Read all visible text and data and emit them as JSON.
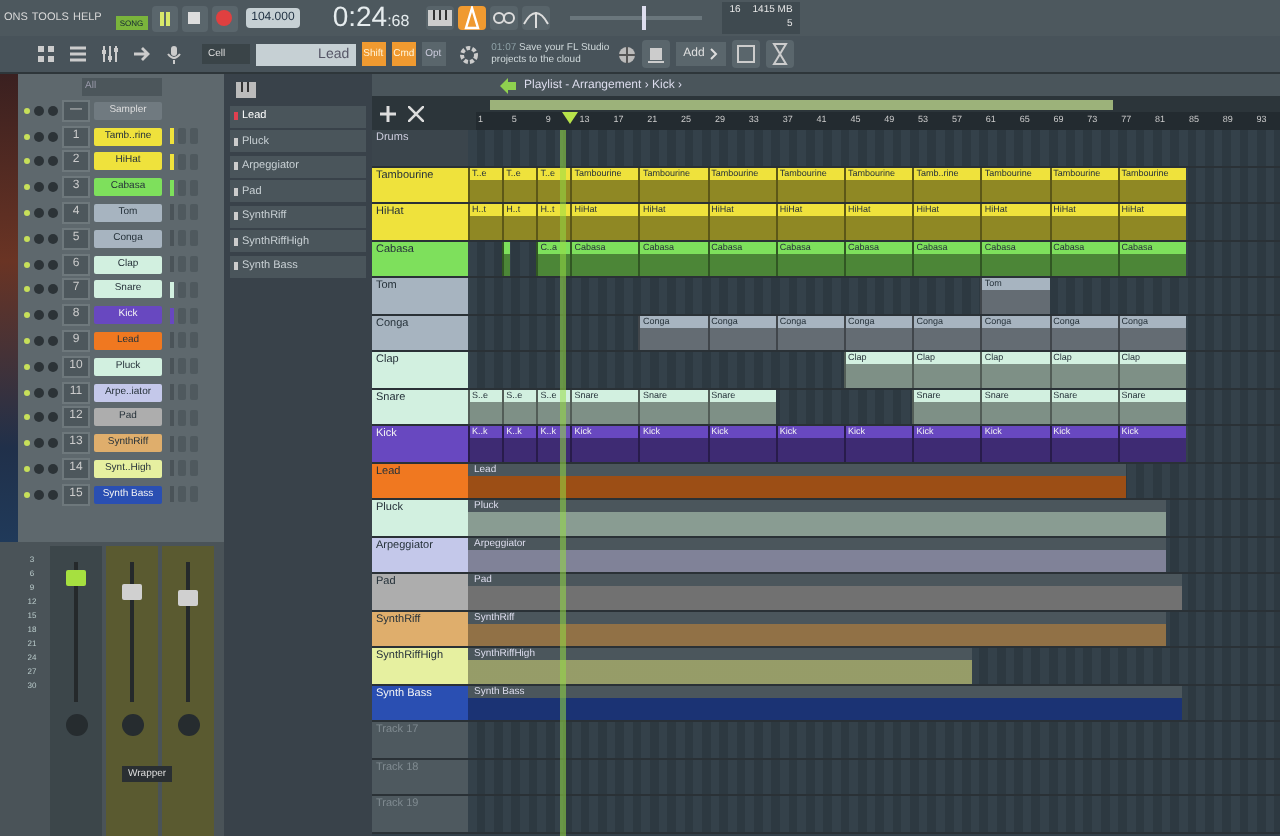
{
  "menu": [
    "ONS",
    "TOOLS",
    "HELP"
  ],
  "transport": {
    "mode": "SONG",
    "playing": true,
    "tempo": "104.000",
    "time_main": "0:24",
    "time_sub": ":68"
  },
  "master_pitch": {
    "level": 0.56
  },
  "stats": {
    "cpu": "16",
    "memory": "1415 MB",
    "voices": "5"
  },
  "toolbar": {
    "snap": "Cell",
    "pattern": "Lead",
    "hint_time": "01:07",
    "hint_text": "Save your FL Studio projects to the cloud",
    "add_button": "Add",
    "modifiers": [
      {
        "label": "Shift",
        "on": true
      },
      {
        "label": "Cmd",
        "on": true
      },
      {
        "label": "Opt",
        "on": false
      }
    ]
  },
  "channel_rack": {
    "filter": "All",
    "sampler_number": "—",
    "sampler": "Sampler",
    "channels": [
      {
        "number": "1",
        "name": "Tamb..rine",
        "color": "#efe23c",
        "active": true
      },
      {
        "number": "2",
        "name": "HiHat",
        "color": "#efe23c",
        "active": true
      },
      {
        "number": "3",
        "name": "Cabasa",
        "color": "#7ee05c",
        "active": true
      },
      {
        "number": "4",
        "name": "Tom",
        "color": "#a7b4c0",
        "active": false
      },
      {
        "number": "5",
        "name": "Conga",
        "color": "#a7b4c0",
        "active": false
      },
      {
        "number": "6",
        "name": "Clap",
        "color": "#d2f0e0",
        "active": false
      },
      {
        "number": "7",
        "name": "Snare",
        "color": "#d2f0e0",
        "active": true
      },
      {
        "number": "8",
        "name": "Kick",
        "color": "#6848c0",
        "active": true
      },
      {
        "number": "9",
        "name": "Lead",
        "color": "#f07820",
        "active": false
      },
      {
        "number": "10",
        "name": "Pluck",
        "color": "#d2f0e0",
        "active": false
      },
      {
        "number": "11",
        "name": "Arpe..iator",
        "color": "#c4c8ea",
        "active": false
      },
      {
        "number": "12",
        "name": "Pad",
        "color": "#adadad",
        "active": false
      },
      {
        "number": "13",
        "name": "SynthRiff",
        "color": "#dfae6c",
        "active": false
      },
      {
        "number": "14",
        "name": "Synt..High",
        "color": "#e6f0a0",
        "active": false
      },
      {
        "number": "15",
        "name": "Synth Bass",
        "color": "#2a4fb2",
        "active": false
      }
    ]
  },
  "patterns": [
    {
      "name": "Lead",
      "selected": true
    },
    {
      "name": "Pluck",
      "selected": false
    },
    {
      "name": "Arpeggiator",
      "selected": false
    },
    {
      "name": "Pad",
      "selected": false
    },
    {
      "name": "SynthRiff",
      "selected": false
    },
    {
      "name": "SynthRiffHigh",
      "selected": false
    },
    {
      "name": "Synth Bass",
      "selected": false
    }
  ],
  "mixer": {
    "scale": [
      "3",
      "6",
      "9",
      "12",
      "15",
      "18",
      "21",
      "24",
      "27",
      "30"
    ],
    "strip_label": "Wrapper",
    "strips": [
      {
        "kind": "master",
        "level": 0.88
      },
      {
        "kind": "insert",
        "level": 0.78
      },
      {
        "kind": "insert",
        "level": 0.75
      }
    ]
  },
  "playlist": {
    "title": "Playlist - Arrangement › Kick ›",
    "group": "Drums",
    "playhead": {
      "level": 0.116
    },
    "ruler": [
      "1",
      "5",
      "9",
      "13",
      "17",
      "21",
      "25",
      "29",
      "33",
      "37",
      "41",
      "45",
      "49",
      "53",
      "57",
      "61",
      "65",
      "69",
      "73",
      "77",
      "81",
      "85",
      "89",
      "93"
    ],
    "tracks": [
      {
        "name": "Tambourine",
        "kind": "drum",
        "color": "#efe23c",
        "slots": [
          {
            "kind": "short",
            "label": "T..e"
          },
          {
            "kind": "short",
            "label": "T..e"
          },
          {
            "kind": "short",
            "label": "T..e"
          },
          {
            "kind": "long",
            "label": "Tambourine"
          },
          {
            "kind": "long",
            "label": "Tambourine"
          },
          {
            "kind": "long",
            "label": "Tambourine"
          },
          {
            "kind": "long",
            "label": "Tambourine"
          },
          {
            "kind": "long",
            "label": "Tambourine"
          },
          {
            "kind": "long",
            "label": "Tamb..rine"
          },
          {
            "kind": "long",
            "label": "Tambourine"
          },
          {
            "kind": "long",
            "label": "Tambourine"
          },
          {
            "kind": "long",
            "label": "Tambourine"
          }
        ]
      },
      {
        "name": "HiHat",
        "kind": "drum",
        "color": "#efe23c",
        "slots": [
          {
            "kind": "short",
            "label": "H..t"
          },
          {
            "kind": "short",
            "label": "H..t"
          },
          {
            "kind": "short",
            "label": "H..t"
          },
          {
            "kind": "long",
            "label": "HiHat"
          },
          {
            "kind": "long",
            "label": "HiHat"
          },
          {
            "kind": "long",
            "label": "HiHat"
          },
          {
            "kind": "long",
            "label": "HiHat"
          },
          {
            "kind": "long",
            "label": "HiHat"
          },
          {
            "kind": "long",
            "label": "HiHat"
          },
          {
            "kind": "long",
            "label": "HiHat"
          },
          {
            "kind": "long",
            "label": "HiHat"
          },
          {
            "kind": "long",
            "label": "HiHat"
          }
        ]
      },
      {
        "name": "Cabasa",
        "kind": "drum",
        "color": "#7ee05c",
        "slots": [
          {
            "kind": "rest"
          },
          {
            "kind": "tick"
          },
          {
            "kind": "short",
            "label": "C..a"
          },
          {
            "kind": "long",
            "label": "Cabasa"
          },
          {
            "kind": "long",
            "label": "Cabasa"
          },
          {
            "kind": "long",
            "label": "Cabasa"
          },
          {
            "kind": "long",
            "label": "Cabasa"
          },
          {
            "kind": "long",
            "label": "Cabasa"
          },
          {
            "kind": "long",
            "label": "Cabasa"
          },
          {
            "kind": "long",
            "label": "Cabasa"
          },
          {
            "kind": "long",
            "label": "Cabasa"
          },
          {
            "kind": "long",
            "label": "Cabasa"
          }
        ]
      },
      {
        "name": "Tom",
        "kind": "drum",
        "color": "#a7b4c0",
        "slots": [
          {
            "kind": "pause"
          },
          {
            "kind": "pause"
          },
          {
            "kind": "pause"
          },
          {
            "kind": "pause"
          },
          {
            "kind": "pause"
          },
          {
            "kind": "pause"
          },
          {
            "kind": "pause"
          },
          {
            "kind": "rest"
          },
          {
            "kind": "long",
            "label": "Tom"
          }
        ]
      },
      {
        "name": "Conga",
        "kind": "drum",
        "color": "#a7b4c0",
        "slots": [
          {
            "kind": "pause"
          },
          {
            "kind": "pause"
          },
          {
            "kind": "rest"
          },
          {
            "kind": "long",
            "label": "Conga"
          },
          {
            "kind": "long",
            "label": "Conga"
          },
          {
            "kind": "long",
            "label": "Conga"
          },
          {
            "kind": "long",
            "label": "Conga"
          },
          {
            "kind": "long",
            "label": "Conga"
          },
          {
            "kind": "long",
            "label": "Conga"
          },
          {
            "kind": "long",
            "label": "Conga"
          },
          {
            "kind": "long",
            "label": "Conga"
          }
        ]
      },
      {
        "name": "Clap",
        "kind": "drum",
        "color": "#d2f0e0",
        "slots": [
          {
            "kind": "pause"
          },
          {
            "kind": "pause"
          },
          {
            "kind": "pause"
          },
          {
            "kind": "pause"
          },
          {
            "kind": "pause"
          },
          {
            "kind": "rest"
          },
          {
            "kind": "long",
            "label": "Clap"
          },
          {
            "kind": "long",
            "label": "Clap"
          },
          {
            "kind": "long",
            "label": "Clap"
          },
          {
            "kind": "long",
            "label": "Clap"
          },
          {
            "kind": "long",
            "label": "Clap"
          }
        ]
      },
      {
        "name": "Snare",
        "kind": "drum",
        "color": "#d2f0e0",
        "slots": [
          {
            "kind": "short",
            "label": "S..e"
          },
          {
            "kind": "short",
            "label": "S..e"
          },
          {
            "kind": "short",
            "label": "S..e"
          },
          {
            "kind": "long",
            "label": "Snare"
          },
          {
            "kind": "long",
            "label": "Snare"
          },
          {
            "kind": "long",
            "label": "Snare"
          },
          {
            "kind": "pause"
          },
          {
            "kind": "pause"
          },
          {
            "kind": "long",
            "label": "Snare"
          },
          {
            "kind": "long",
            "label": "Snare"
          },
          {
            "kind": "long",
            "label": "Snare"
          },
          {
            "kind": "long",
            "label": "Snare"
          }
        ]
      },
      {
        "name": "Kick",
        "kind": "drum",
        "color": "#6848c0",
        "slots": [
          {
            "kind": "short",
            "label": "K..k"
          },
          {
            "kind": "short",
            "label": "K..k"
          },
          {
            "kind": "short",
            "label": "K..k"
          },
          {
            "kind": "long",
            "label": "Kick"
          },
          {
            "kind": "long",
            "label": "Kick"
          },
          {
            "kind": "long",
            "label": "Kick"
          },
          {
            "kind": "long",
            "label": "Kick"
          },
          {
            "kind": "long",
            "label": "Kick"
          },
          {
            "kind": "long",
            "label": "Kick"
          },
          {
            "kind": "long",
            "label": "Kick"
          },
          {
            "kind": "long",
            "label": "Kick"
          },
          {
            "kind": "long",
            "label": "Kick"
          }
        ]
      },
      {
        "name": "Lead",
        "kind": "pattern",
        "color": "#f07820",
        "clip": {
          "label": "Lead",
          "level": 0.81
        }
      },
      {
        "name": "Pluck",
        "kind": "pattern",
        "color": "#d2f0e0",
        "clip": {
          "label": "Pluck",
          "level": 0.86
        }
      },
      {
        "name": "Arpeggiator",
        "kind": "pattern",
        "color": "#c4c8ea",
        "clip": {
          "label": "Arpeggiator",
          "level": 0.86
        }
      },
      {
        "name": "Pad",
        "kind": "pattern",
        "color": "#adadad",
        "clip": {
          "label": "Pad",
          "level": 0.88
        }
      },
      {
        "name": "SynthRiff",
        "kind": "pattern",
        "color": "#dfae6c",
        "clip": {
          "label": "SynthRiff",
          "level": 0.86
        }
      },
      {
        "name": "SynthRiffHigh",
        "kind": "pattern",
        "color": "#e6f0a0",
        "clip": {
          "label": "SynthRiffHigh",
          "level": 0.62
        }
      },
      {
        "name": "Synth Bass",
        "kind": "pattern",
        "color": "#2a4fb2",
        "clip": {
          "label": "Synth Bass",
          "level": 0.88
        }
      },
      {
        "name": "Track 17",
        "kind": "empty"
      },
      {
        "name": "Track 18",
        "kind": "empty"
      },
      {
        "name": "Track 19",
        "kind": "empty"
      }
    ]
  }
}
